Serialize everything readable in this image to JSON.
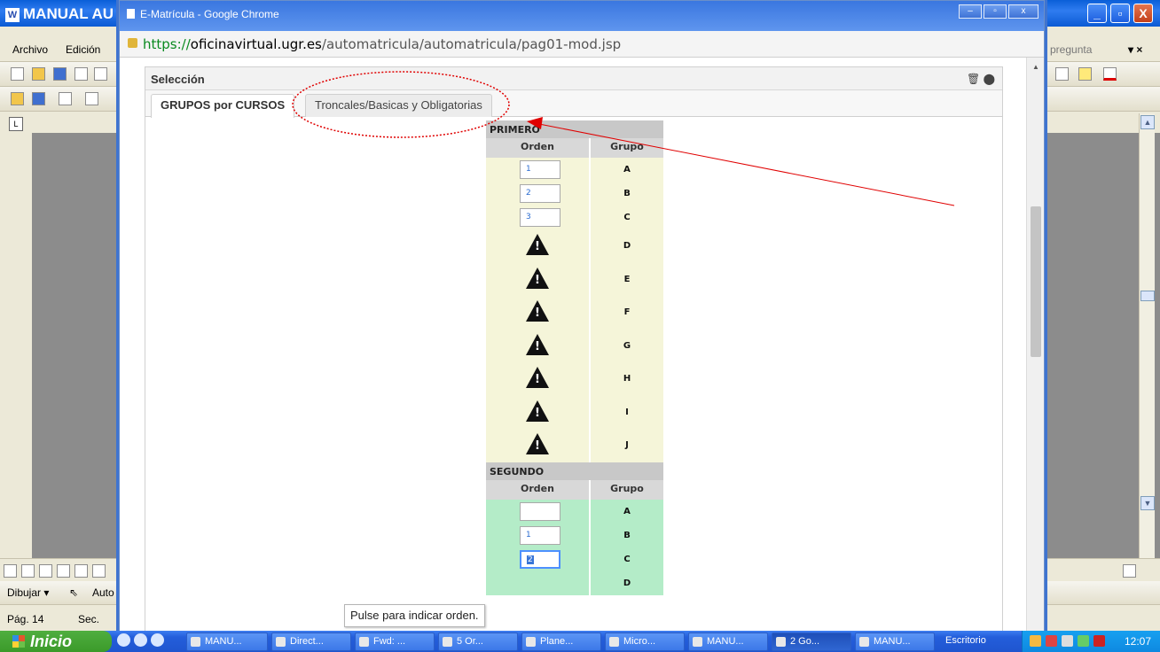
{
  "word": {
    "title": "MANUAL AU",
    "menu": {
      "archivo": "Archivo",
      "edicion": "Edición",
      "pregunta": "pregunta",
      "close_x": "▾ ×"
    },
    "ruler_corner": "L",
    "draw_label": "Dibujar ▾",
    "auto_label": "Auto",
    "status": {
      "page": "Pág. 14",
      "sec": "Sec."
    }
  },
  "chrome": {
    "title": "E-Matrícula - Google Chrome",
    "url_scheme": "https://",
    "url_host": "oficinavirtual.ugr.es",
    "url_path": "/automatricula/automatricula/pag01-mod.jsp"
  },
  "panel": {
    "title": "Selección",
    "tabs": [
      "GRUPOS por CURSOS",
      "Troncales/Basicas y Obligatorias"
    ]
  },
  "selection": {
    "col_orden": "Orden",
    "col_grupo": "Grupo",
    "primero": {
      "title": "PRIMERO",
      "rows": [
        {
          "orden": "1",
          "grupo": "A"
        },
        {
          "orden": "2",
          "grupo": "B"
        },
        {
          "orden": "3",
          "grupo": "C"
        },
        {
          "grupo": "D"
        },
        {
          "grupo": "E"
        },
        {
          "grupo": "F"
        },
        {
          "grupo": "G"
        },
        {
          "grupo": "H"
        },
        {
          "grupo": "I"
        },
        {
          "grupo": "J"
        }
      ]
    },
    "segundo": {
      "title": "SEGUNDO",
      "rows": [
        {
          "orden": "",
          "grupo": "A"
        },
        {
          "orden": "1",
          "grupo": "B"
        },
        {
          "orden": "2",
          "grupo": "C"
        },
        {
          "grupo": "D"
        }
      ]
    }
  },
  "tooltip": "Pulse para indicar orden.",
  "taskbar": {
    "start": "Inicio",
    "tasks": [
      "MANU...",
      "Direct...",
      "Fwd: ...",
      "5 Or...",
      "Plane...",
      "Micro...",
      "MANU...",
      "2 Go...",
      "MANU...",
      "Escritorio"
    ],
    "clock": "12:07"
  },
  "colors": {
    "annotation_red": "#e00000",
    "primero_bg": "#f5f5d9",
    "segundo_bg": "#b4ecc8",
    "url_scheme": "#0a8a1f"
  }
}
